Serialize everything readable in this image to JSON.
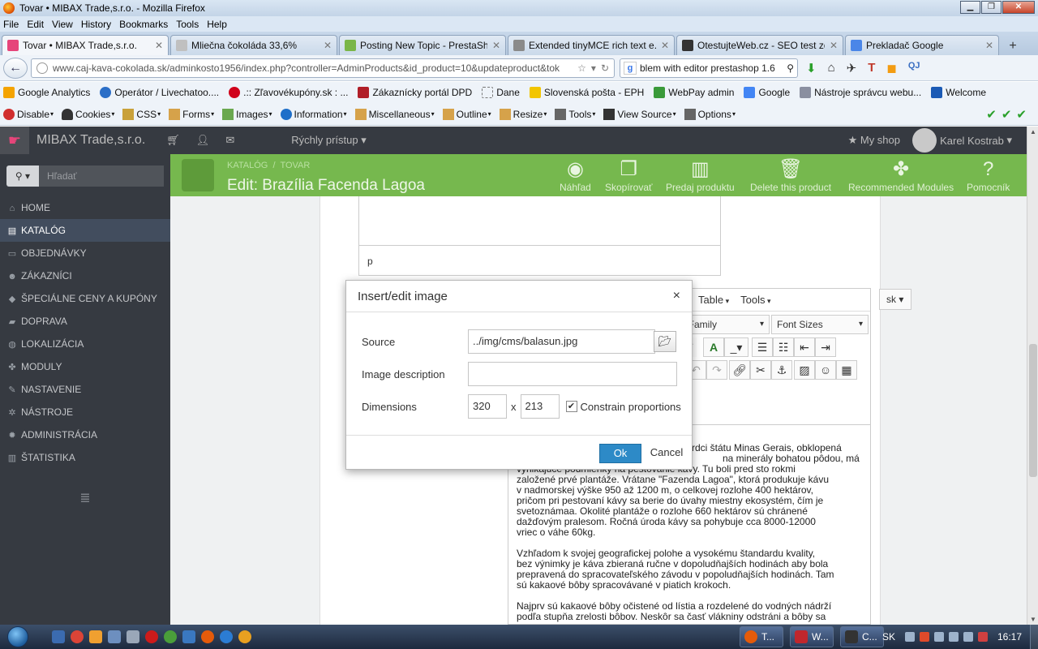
{
  "window": {
    "title": "Tovar • MIBAX Trade,s.r.o. - Mozilla Firefox"
  },
  "menubar": [
    "File",
    "Edit",
    "View",
    "History",
    "Bookmarks",
    "Tools",
    "Help"
  ],
  "tabs": [
    {
      "label": "Tovar • MIBAX Trade,s.r.o.",
      "color": "#e6457a"
    },
    {
      "label": "Mliečna čokoláda 33,6%",
      "color": "#c0c0c0"
    },
    {
      "label": "Posting New Topic - PrestaSh...",
      "color": "#7ab648"
    },
    {
      "label": "Extended tinyMCE rich text e...",
      "color": "#8a8a8a"
    },
    {
      "label": "OtestujteWeb.cz - SEO test zd...",
      "color": "#333333"
    },
    {
      "label": "Prekladač Google",
      "color": "#4a86e8"
    }
  ],
  "nav": {
    "url": "www.caj-kava-cokolada.sk/adminkosto1956/index.php?controller=AdminProducts&id_product=10&updateproduct&tok",
    "search": "blem with editor prestashop 1.6"
  },
  "bookmarks": [
    {
      "label": "Google Analytics",
      "color": "#f4a300"
    },
    {
      "label": "Operátor / Livechatoo....",
      "color": "#2b6ec7"
    },
    {
      "label": ".:: Zľavovékupóny.sk : ...",
      "color": "#d0021b"
    },
    {
      "label": "Zákaznícky portál DPD",
      "color": "#b01e28"
    },
    {
      "label": "Dane",
      "color": "#ffffff"
    },
    {
      "label": "Slovenská pošta - EPH",
      "color": "#f2c500"
    },
    {
      "label": "WebPay admin",
      "color": "#3a9a3a"
    },
    {
      "label": "Google",
      "color": "#4285f4"
    },
    {
      "label": "Nástroje správcu webu...",
      "color": "#8a8fa0"
    },
    {
      "label": "Welcome",
      "color": "#1b5ab5"
    }
  ],
  "devtoolbar": [
    {
      "label": "Disable",
      "color": "#d12f2f"
    },
    {
      "label": "Cookies",
      "color": "#333333"
    },
    {
      "label": "CSS",
      "color": "#c9a13a"
    },
    {
      "label": "Forms",
      "color": "#d6a24a"
    },
    {
      "label": "Images",
      "color": "#6aa84f"
    },
    {
      "label": "Information",
      "color": "#1f6fc9"
    },
    {
      "label": "Miscellaneous",
      "color": "#d6a24a"
    },
    {
      "label": "Outline",
      "color": "#d6a24a"
    },
    {
      "label": "Resize",
      "color": "#d6a24a"
    },
    {
      "label": "Tools",
      "color": "#666666"
    },
    {
      "label": "View Source",
      "color": "#333333"
    },
    {
      "label": "Options",
      "color": "#666666"
    }
  ],
  "ps_header": {
    "shop_name": "MIBAX Trade,s.r.o.",
    "quick_access": "Rýchly prístup",
    "my_shop": "My shop",
    "user": "Karel Kostrab"
  },
  "sidebar": {
    "search_placeholder": "Hľadať",
    "items": [
      {
        "label": "HOME",
        "icon": "home-icon",
        "active": false
      },
      {
        "label": "KATALÓG",
        "icon": "book-icon",
        "active": true
      },
      {
        "label": "OBJEDNÁVKY",
        "icon": "card-icon",
        "active": false
      },
      {
        "label": "ZÁKAZNÍCI",
        "icon": "users-icon",
        "active": false
      },
      {
        "label": "ŠPECIÁLNE CENY A KUPÓNY",
        "icon": "tag-icon",
        "active": false
      },
      {
        "label": "DOPRAVA",
        "icon": "truck-icon",
        "active": false
      },
      {
        "label": "LOKALIZÁCIA",
        "icon": "globe-icon",
        "active": false
      },
      {
        "label": "MODULY",
        "icon": "puzzle-icon",
        "active": false
      },
      {
        "label": "NASTAVENIE",
        "icon": "wrench-icon",
        "active": false
      },
      {
        "label": "NÁSTROJE",
        "icon": "cogs-icon",
        "active": false
      },
      {
        "label": "ADMINISTRÁCIA",
        "icon": "cog-icon",
        "active": false
      },
      {
        "label": "ŠTATISTIKA",
        "icon": "chart-icon",
        "active": false
      }
    ]
  },
  "toolbar": {
    "breadcrumb_1": "KATALÓG",
    "breadcrumb_sep": "/",
    "breadcrumb_2": "TOVAR",
    "title": "Edit: Brazília Facenda Lagoa",
    "buttons": {
      "preview": "Náhľad",
      "duplicate": "Skopírovať",
      "sales": "Predaj produktu",
      "delete": "Delete this product",
      "modules": "Recommended Modules",
      "help": "Pomocník"
    }
  },
  "editor": {
    "prev_paragraph": "p",
    "menu": [
      "Table",
      "Tools"
    ],
    "font_family": "t Family",
    "font_sizes": "Font Sizes",
    "lang": "sk",
    "text_lines_1": [
      "rdci štátu Minas Gerais, obklopená",
      "na minerály bohatou pôdou, má",
      "vynikajúce podmienky na pestovanie kávy. Tu boli pred sto rokmi",
      "založené prvé plantáže. Vrátane \"Fazenda Lagoa\", ktorá produkuje kávu",
      "v nadmorskej výške 950 až 1200 m, o celkovej rozlohe 400 hektárov,",
      "pričom pri pestovaní kávy sa berie do úvahy miestny ekosystém, čím je",
      "svetoznámaa. Okolité plantáže o rozlohe 660 hektárov sú chránené",
      "dažďovým pralesom. Ročná úroda kávy sa pohybuje cca 8000-12000",
      "vriec o váhe 60kg."
    ],
    "text_lines_2": [
      "Vzhľadom k svojej geografickej polohe a vysokému štandardu kvality,",
      "bez výnimky je káva zbieraná ručne v dopoludňajších hodinách aby bola",
      "prepravená do spracovateľského závodu v popoludňajších hodinách. Tam",
      "sú kakaové bôby spracovávané v piatich krokoch."
    ],
    "text_lines_3": [
      "Najprv sú kakaové bôby očistené od lístia a rozdelené do vodných nádrží",
      "podľa stupňa zrelosti bôbov. Neskôr sa časť vlákniny odstráni a bôby sa"
    ]
  },
  "modal": {
    "title": "Insert/edit image",
    "close": "×",
    "source_label": "Source",
    "source_value": "../img/cms/balasun.jpg",
    "description_label": "Image description",
    "description_value": "",
    "dimensions_label": "Dimensions",
    "width": "320",
    "x": "x",
    "height": "213",
    "constrain_label": "Constrain proportions",
    "constrain_checked": "✔",
    "ok": "Ok",
    "cancel": "Cancel"
  },
  "taskbar": {
    "tasks": [
      {
        "label": "T...",
        "color": "#e55b0a"
      },
      {
        "label": "W...",
        "color": "#c0272d"
      },
      {
        "label": "C...",
        "color": "#333333"
      }
    ],
    "lang": "SK",
    "clock": "16:17"
  }
}
